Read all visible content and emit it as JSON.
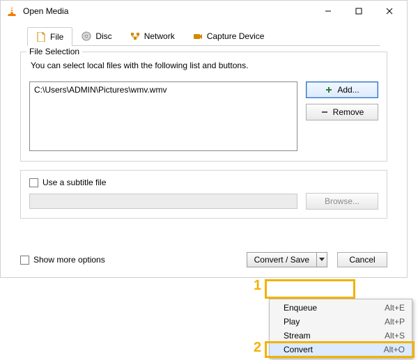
{
  "title": "Open Media",
  "tabs": {
    "file": "File",
    "disc": "Disc",
    "network": "Network",
    "capture": "Capture Device"
  },
  "file_selection": {
    "legend": "File Selection",
    "description": "You can select local files with the following list and buttons.",
    "files": [
      "C:\\Users\\ADMIN\\Pictures\\wmv.wmv"
    ],
    "add_label": "Add...",
    "remove_label": "Remove"
  },
  "subtitle": {
    "checkbox_label": "Use a subtitle file",
    "browse_label": "Browse..."
  },
  "more_options_label": "Show more options",
  "convert_save_label": "Convert / Save",
  "cancel_label": "Cancel",
  "menu": [
    {
      "label": "Enqueue",
      "accel": "Alt+E"
    },
    {
      "label": "Play",
      "accel": "Alt+P"
    },
    {
      "label": "Stream",
      "accel": "Alt+S"
    },
    {
      "label": "Convert",
      "accel": "Alt+O"
    }
  ],
  "callouts": {
    "one": "1",
    "two": "2"
  }
}
